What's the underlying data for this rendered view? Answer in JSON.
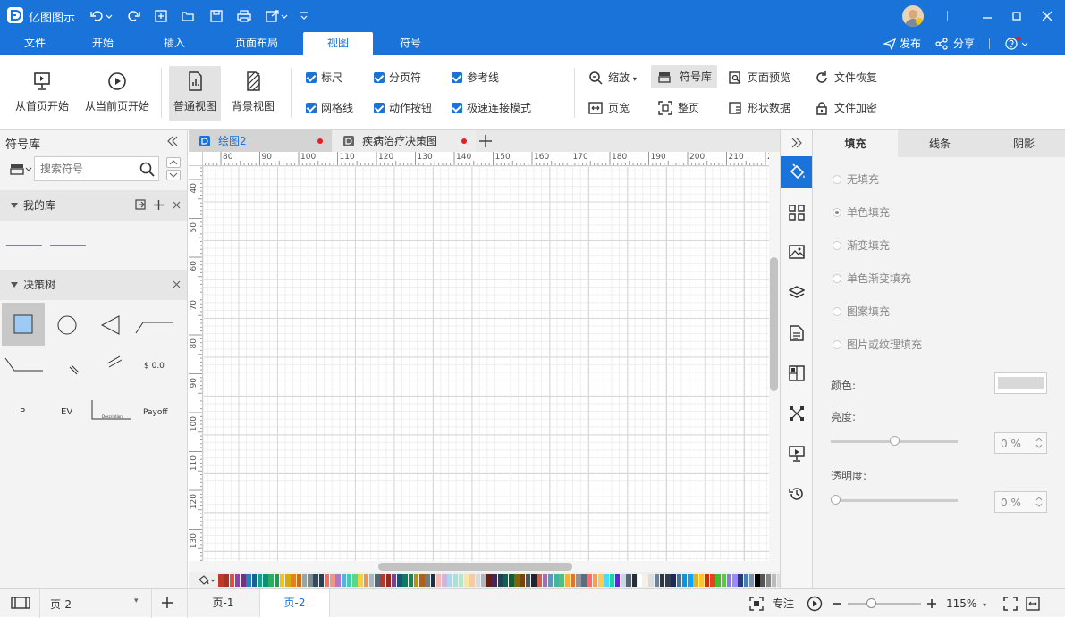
{
  "app": {
    "title": "亿图图示"
  },
  "menu": {
    "tabs": [
      "文件",
      "开始",
      "插入",
      "页面布局",
      "视图",
      "符号"
    ],
    "active": 4,
    "publish": "发布",
    "share": "分享"
  },
  "ribbon": {
    "from_first": "从首页开始",
    "from_current": "从当前页开始",
    "normal_view": "普通视图",
    "background_view": "背景视图",
    "checks": {
      "ruler": "标尺",
      "pagebreak": "分页符",
      "guide": "参考线",
      "grid": "网格线",
      "action_btn": "动作按钮",
      "fast_connect": "极速连接模式"
    },
    "zoom": "缩放",
    "symbol_lib": "符号库",
    "page_preview": "页面预览",
    "file_recover": "文件恢复",
    "page_width": "页宽",
    "whole_page": "整页",
    "shape_data": "形状数据",
    "file_encrypt": "文件加密"
  },
  "left": {
    "title": "符号库",
    "search_placeholder": "搜索符号",
    "my_lib": "我的库",
    "decision_tree": "决策树",
    "shape_labels": {
      "s8": "$ 0.0",
      "s9": "P",
      "s10": "EV",
      "s11": "Description",
      "s12": "Payoff"
    }
  },
  "doc_tabs": [
    {
      "label": "绘图2"
    },
    {
      "label": "疾病治疗决策图"
    }
  ],
  "ruler": {
    "h": [
      "80",
      "90",
      "100",
      "110",
      "120",
      "130",
      "140",
      "150",
      "160",
      "170",
      "180",
      "190",
      "200",
      "210",
      "2"
    ],
    "v": [
      "40",
      "50",
      "60",
      "70",
      "80",
      "90",
      "100",
      "110",
      "120",
      "130"
    ]
  },
  "right": {
    "tabs": [
      "填充",
      "线条",
      "阴影"
    ],
    "options": [
      "无填充",
      "单色填充",
      "渐变填充",
      "单色渐变填充",
      "图案填充",
      "图片或纹理填充"
    ],
    "selected_option": 1,
    "color_label": "颜色:",
    "brightness_label": "亮度:",
    "brightness_value": "0 %",
    "transparency_label": "透明度:",
    "transparency_value": "0 %",
    "brightness_level": 0.5,
    "transparency_level": 0
  },
  "status": {
    "page_select": "页-2",
    "pages": [
      "页-1",
      "页-2"
    ],
    "active_page": 1,
    "focus": "专注",
    "zoom": "115%",
    "zoom_level": 0.3
  },
  "colors": {
    "accent": "#1a73d9",
    "red_dot": "#e02020",
    "palette": [
      "#c0392b",
      "#a93226",
      "#e74c3c",
      "#8e44ad",
      "#6c3483",
      "#2980b9",
      "#1f618d",
      "#16a085",
      "#138d75",
      "#27ae60",
      "#229954",
      "#f1c40f",
      "#d4ac0d",
      "#e67e22",
      "#ca6f1e",
      "#95a5a6",
      "#7f8c8d",
      "#34495e",
      "#2c3e50",
      "#ec7063",
      "#f1948a",
      "#af7ac5",
      "#5dade2",
      "#48c9b0",
      "#58d68d",
      "#f4d03f",
      "#eb984e",
      "#aab7b8",
      "#566573",
      "#b03a2e",
      "#922b21",
      "#76448a",
      "#1a5276",
      "#117864",
      "#1e8449",
      "#b7950b",
      "#af601a",
      "#717d7e",
      "#212f3d",
      "#f5b7b1",
      "#d2b4de",
      "#aed6f1",
      "#a3e4d7",
      "#abebc6",
      "#f9e79f",
      "#f5cba7",
      "#d5dbdb",
      "#aeb6bf",
      "#641e16",
      "#4a235a",
      "#154360",
      "#0e6251",
      "#145a32",
      "#7d6608",
      "#784212",
      "#4d5656",
      "#1b2631",
      "#cd6155",
      "#a569bd",
      "#5499c7",
      "#45b39d",
      "#52be80",
      "#f5b041",
      "#dc7633",
      "#909497",
      "#5d6d7e",
      "#ff6b6b",
      "#ff9f43",
      "#feca57",
      "#48dbfb",
      "#1dd1a1",
      "#5f27cd",
      "#c8d6e5",
      "#576574",
      "#222f3e",
      "#ffffff",
      "#f7f1e3",
      "#dcdde1",
      "#718093",
      "#2f3640",
      "#353b48",
      "#192a56",
      "#40739e",
      "#0097e6",
      "#00a8ff",
      "#e1b12c",
      "#fbc531",
      "#c23616",
      "#e84118",
      "#44bd32",
      "#4cd137",
      "#8c7ae6",
      "#9c88ff",
      "#273c75",
      "#487eb0",
      "#7f8fa6",
      "#000000",
      "#555555",
      "#888888",
      "#bbbbbb",
      "#dddddd"
    ]
  }
}
